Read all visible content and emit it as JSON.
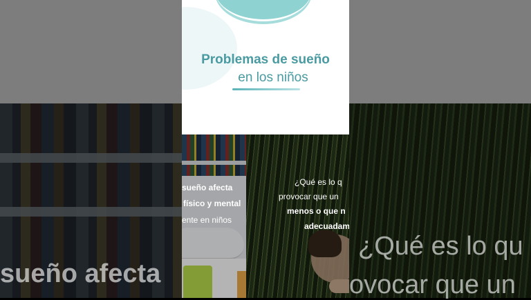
{
  "title_card": {
    "line1": "Problemas de sueño",
    "line2": "en los niños"
  },
  "left_clip": {
    "line1": "sueño afecta",
    "line2": "físico y mental",
    "line3": "ente en niños"
  },
  "right_clip": {
    "line1": "¿Qué es lo q",
    "line2": "provocar que un",
    "line3": "menos o que n",
    "line4": "adecuadam"
  },
  "backdrop": {
    "left_text": "sueño afecta",
    "right_text1": "¿Qué es lo qu",
    "right_text2": "ovocar que un"
  },
  "colors": {
    "accent": "#4a9ba1",
    "blob": "#8fd2d2"
  }
}
